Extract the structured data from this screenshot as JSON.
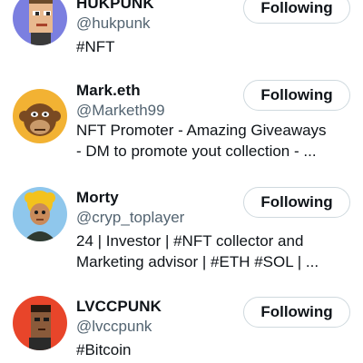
{
  "following_list": {
    "users": [
      {
        "name": "HUKPUNK",
        "handle": "@hukpunk",
        "bio_lines": [
          "#NFT"
        ],
        "button_label": "Following",
        "avatar_icon": "pixel-punk-avatar-icon",
        "avatar_bg": "#7b7fe0"
      },
      {
        "name": "Mark.eth",
        "handle": "@Marketh99",
        "bio_lines": [
          "NFT Promoter - Amazing Giveaways",
          "- DM to promote yout collection - ..."
        ],
        "button_label": "Following",
        "avatar_icon": "ape-avatar-icon",
        "avatar_bg": "#f2b233"
      },
      {
        "name": "Morty",
        "handle": "@cryp_toplayer",
        "bio_lines": [
          "24 | Investor | #NFT collector and",
          "Marketing advisor | #ETH #SOL | ..."
        ],
        "button_label": "Following",
        "avatar_icon": "cartoon-character-avatar-icon",
        "avatar_bg": "#8fc7ec"
      },
      {
        "name": "LVCCPUNK",
        "handle": "@lvccpunk",
        "bio_lines": [
          "#Bitcoin"
        ],
        "button_label": "Following",
        "avatar_icon": "pixel-punk-avatar-icon",
        "avatar_bg": "#e8452a"
      }
    ]
  }
}
